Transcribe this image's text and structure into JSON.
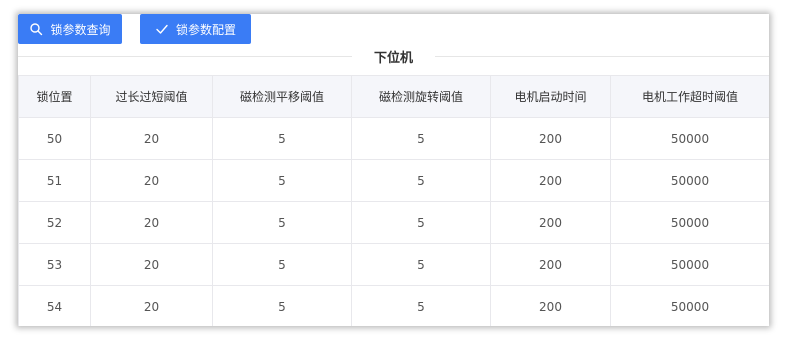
{
  "toolbar": {
    "query_label": "锁参数查询",
    "config_label": "锁参数配置",
    "accent_color": "#3a7cf5"
  },
  "section": {
    "title": "下位机"
  },
  "table": {
    "columns": [
      "锁位置",
      "过长过短阈值",
      "磁检测平移阈值",
      "磁检测旋转阈值",
      "电机启动时间",
      "电机工作超时阈值"
    ],
    "rows": [
      [
        "50",
        "20",
        "5",
        "5",
        "200",
        "50000"
      ],
      [
        "51",
        "20",
        "5",
        "5",
        "200",
        "50000"
      ],
      [
        "52",
        "20",
        "5",
        "5",
        "200",
        "50000"
      ],
      [
        "53",
        "20",
        "5",
        "5",
        "200",
        "50000"
      ],
      [
        "54",
        "20",
        "5",
        "5",
        "200",
        "50000"
      ]
    ]
  }
}
